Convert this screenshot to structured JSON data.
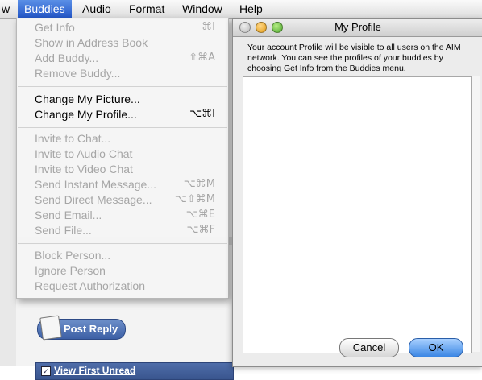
{
  "menubar": {
    "items": [
      {
        "label": "w"
      },
      {
        "label": "Buddies"
      },
      {
        "label": "Audio"
      },
      {
        "label": "Format"
      },
      {
        "label": "Window"
      },
      {
        "label": "Help"
      }
    ]
  },
  "buddies_menu": {
    "items": [
      {
        "label": "Get Info",
        "shortcut": "⌘I",
        "enabled": false
      },
      {
        "label": "Show in Address Book",
        "shortcut": "",
        "enabled": false
      },
      {
        "label": "Add Buddy...",
        "shortcut": "⇧⌘A",
        "enabled": false
      },
      {
        "label": "Remove Buddy...",
        "shortcut": "",
        "enabled": false
      },
      {
        "label": "Change My Picture...",
        "shortcut": "",
        "enabled": true
      },
      {
        "label": "Change My Profile...",
        "shortcut": "⌥⌘I",
        "enabled": true
      },
      {
        "label": "Invite to Chat...",
        "shortcut": "",
        "enabled": false
      },
      {
        "label": "Invite to Audio Chat",
        "shortcut": "",
        "enabled": false
      },
      {
        "label": "Invite to Video Chat",
        "shortcut": "",
        "enabled": false
      },
      {
        "label": "Send Instant Message...",
        "shortcut": "⌥⌘M",
        "enabled": false
      },
      {
        "label": "Send Direct Message...",
        "shortcut": "⌥⇧⌘M",
        "enabled": false
      },
      {
        "label": "Send Email...",
        "shortcut": "⌥⌘E",
        "enabled": false
      },
      {
        "label": "Send File...",
        "shortcut": "⌥⌘F",
        "enabled": false
      },
      {
        "label": "Block Person...",
        "shortcut": "",
        "enabled": false
      },
      {
        "label": "Ignore Person",
        "shortcut": "",
        "enabled": false
      },
      {
        "label": "Request Authorization",
        "shortcut": "",
        "enabled": false
      }
    ]
  },
  "profile_window": {
    "title": "My Profile",
    "description": "Your account Profile will be visible to all users on the AIM network. You can see the profiles of your buddies by choosing Get Info from the Buddies menu.",
    "profile_text": "",
    "cancel_label": "Cancel",
    "ok_label": "OK"
  },
  "background_page": {
    "post_reply_label": "Post Reply",
    "view_first_unread_label": "View First Unread"
  },
  "colors": {
    "menu_highlight": "#2457c8",
    "default_button": "#3b86e4",
    "disabled_text": "#a6a6a6"
  }
}
